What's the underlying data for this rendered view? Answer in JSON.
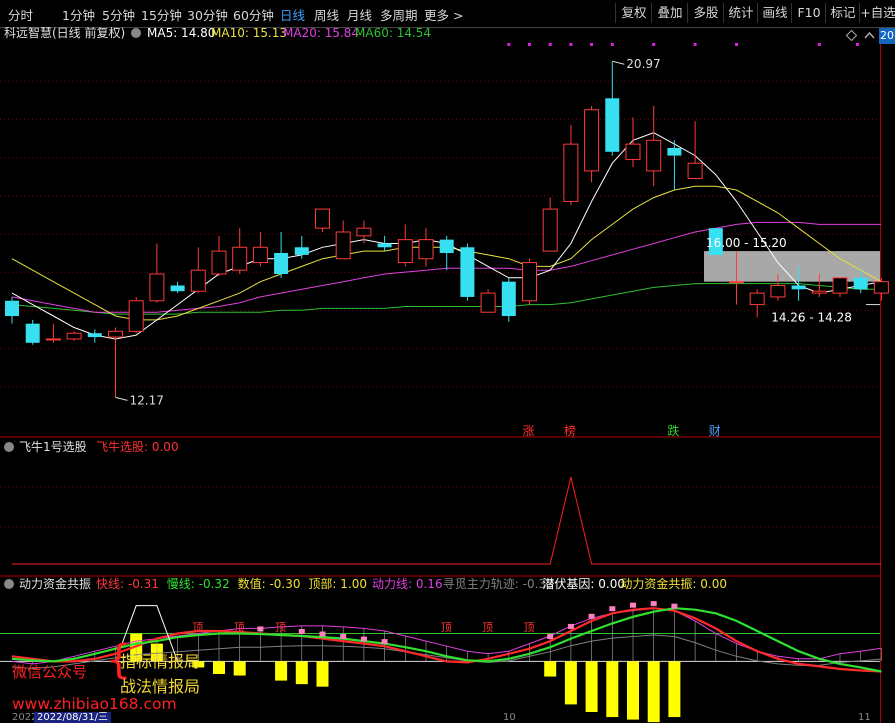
{
  "toolbar": {
    "periods": [
      {
        "label": "分时",
        "active": false
      },
      {
        "label": "1分钟",
        "active": false
      },
      {
        "label": "5分钟",
        "active": false
      },
      {
        "label": "15分钟",
        "active": false
      },
      {
        "label": "30分钟",
        "active": false
      },
      {
        "label": "60分钟",
        "active": false
      },
      {
        "label": "日线",
        "active": true
      },
      {
        "label": "周线",
        "active": false
      },
      {
        "label": "月线",
        "active": false
      },
      {
        "label": "多周期",
        "active": false
      },
      {
        "label": "更多 >",
        "active": false
      }
    ],
    "buttons": [
      "复权",
      "叠加",
      "多股",
      "统计",
      "画线",
      "F10",
      "标记",
      "+自选"
    ]
  },
  "main_info": {
    "title": "科远智慧(日线 前复权)",
    "ma5": "MA5: 14.80",
    "ma10": "MA10: 15.13",
    "ma20": "MA20: 15.84",
    "ma60": "MA60: 14.54",
    "right_tag": "20"
  },
  "colors": {
    "up": "#ff3a3a",
    "down": "#36e0f0",
    "ma5": "#ffffff",
    "ma10": "#e8e040",
    "ma20": "#e040e0",
    "ma60": "#30c030",
    "grid": "#7a0000",
    "signal": "#ff2020"
  },
  "chart_data": [
    {
      "type": "candlestick",
      "name": "main",
      "ylim": [
        11.5,
        21.5
      ],
      "candles": [
        {
          "o": 14.7,
          "c": 14.3,
          "h": 14.8,
          "l": 14.1
        },
        {
          "o": 14.1,
          "c": 13.6,
          "h": 14.2,
          "l": 13.55
        },
        {
          "o": 13.7,
          "c": 13.7,
          "h": 14.1,
          "l": 13.6
        },
        {
          "o": 13.7,
          "c": 13.85,
          "h": 13.9,
          "l": 13.65
        },
        {
          "o": 13.85,
          "c": 13.75,
          "h": 13.95,
          "l": 13.6
        },
        {
          "o": 13.75,
          "c": 13.9,
          "h": 14.0,
          "l": 12.17
        },
        {
          "o": 13.9,
          "c": 14.7,
          "h": 14.8,
          "l": 13.85
        },
        {
          "o": 14.7,
          "c": 15.4,
          "h": 16.2,
          "l": 14.65
        },
        {
          "o": 15.1,
          "c": 14.95,
          "h": 15.2,
          "l": 14.9
        },
        {
          "o": 14.95,
          "c": 15.5,
          "h": 16.1,
          "l": 14.9
        },
        {
          "o": 15.4,
          "c": 16.0,
          "h": 16.4,
          "l": 15.35
        },
        {
          "o": 15.5,
          "c": 16.1,
          "h": 16.6,
          "l": 15.4
        },
        {
          "o": 15.7,
          "c": 16.1,
          "h": 16.5,
          "l": 15.6
        },
        {
          "o": 15.95,
          "c": 15.4,
          "h": 16.5,
          "l": 15.3
        },
        {
          "o": 16.1,
          "c": 15.9,
          "h": 16.4,
          "l": 15.8
        },
        {
          "o": 16.6,
          "c": 17.1,
          "h": 17.1,
          "l": 16.5
        },
        {
          "o": 15.8,
          "c": 16.5,
          "h": 16.8,
          "l": 15.8
        },
        {
          "o": 16.4,
          "c": 16.6,
          "h": 16.8,
          "l": 16.2
        },
        {
          "o": 16.2,
          "c": 16.1,
          "h": 16.4,
          "l": 16.0
        },
        {
          "o": 15.7,
          "c": 16.3,
          "h": 16.7,
          "l": 15.6
        },
        {
          "o": 15.8,
          "c": 16.3,
          "h": 16.6,
          "l": 15.6
        },
        {
          "o": 16.3,
          "c": 15.95,
          "h": 16.4,
          "l": 15.5
        },
        {
          "o": 16.1,
          "c": 14.8,
          "h": 16.2,
          "l": 14.7
        },
        {
          "o": 14.4,
          "c": 14.9,
          "h": 15.0,
          "l": 14.4
        },
        {
          "o": 15.2,
          "c": 14.3,
          "h": 15.3,
          "l": 14.15
        },
        {
          "o": 14.7,
          "c": 15.7,
          "h": 15.8,
          "l": 14.6
        },
        {
          "o": 16.0,
          "c": 17.1,
          "h": 17.4,
          "l": 16.0
        },
        {
          "o": 17.3,
          "c": 18.8,
          "h": 19.3,
          "l": 17.2
        },
        {
          "o": 18.1,
          "c": 19.7,
          "h": 19.8,
          "l": 17.8
        },
        {
          "o": 20.0,
          "c": 18.6,
          "h": 20.97,
          "l": 18.5
        },
        {
          "o": 18.4,
          "c": 18.8,
          "h": 19.5,
          "l": 18.2
        },
        {
          "o": 18.1,
          "c": 18.9,
          "h": 19.8,
          "l": 17.7
        },
        {
          "o": 18.7,
          "c": 18.5,
          "h": 18.9,
          "l": 17.6
        },
        {
          "o": 17.9,
          "c": 18.3,
          "h": 19.4,
          "l": 17.9
        },
        {
          "o": 16.6,
          "c": 15.9,
          "h": 16.6,
          "l": 15.9
        },
        {
          "o": 15.2,
          "c": 15.2,
          "h": 16.0,
          "l": 14.6
        },
        {
          "o": 14.6,
          "c": 14.9,
          "h": 15.0,
          "l": 14.26
        },
        {
          "o": 14.8,
          "c": 15.1,
          "h": 15.4,
          "l": 14.7
        },
        {
          "o": 15.1,
          "c": 15.0,
          "h": 15.6,
          "l": 14.7
        },
        {
          "o": 14.9,
          "c": 14.95,
          "h": 15.4,
          "l": 14.8
        },
        {
          "o": 14.9,
          "c": 15.3,
          "h": 15.3,
          "l": 14.8
        },
        {
          "o": 15.3,
          "c": 15.0,
          "h": 15.5,
          "l": 14.9
        },
        {
          "o": 14.9,
          "c": 15.2,
          "h": 15.3,
          "l": 14.7
        }
      ],
      "ma5": [
        14.9,
        14.6,
        14.3,
        14.0,
        13.8,
        13.7,
        13.8,
        14.2,
        14.6,
        15.0,
        15.4,
        15.6,
        15.8,
        15.8,
        15.9,
        16.1,
        16.2,
        16.3,
        16.2,
        16.2,
        16.3,
        16.2,
        15.9,
        15.6,
        15.3,
        15.3,
        15.5,
        16.2,
        17.3,
        18.3,
        18.9,
        19.1,
        18.8,
        18.5,
        18.0,
        17.3,
        16.5,
        15.7,
        15.1,
        14.9,
        15.0,
        15.1,
        15.2
      ],
      "ma10": [
        15.8,
        15.5,
        15.2,
        14.9,
        14.6,
        14.3,
        14.2,
        14.2,
        14.3,
        14.5,
        14.7,
        14.9,
        15.2,
        15.4,
        15.6,
        15.8,
        15.9,
        16.0,
        16.0,
        16.1,
        16.1,
        16.1,
        16.0,
        15.9,
        15.8,
        15.6,
        15.6,
        15.8,
        16.3,
        16.7,
        17.1,
        17.4,
        17.6,
        17.7,
        17.7,
        17.6,
        17.3,
        17.0,
        16.6,
        16.2,
        15.8,
        15.5,
        15.2
      ],
      "ma20": [
        14.8,
        14.7,
        14.6,
        14.5,
        14.4,
        14.4,
        14.4,
        14.4,
        14.45,
        14.5,
        14.55,
        14.65,
        14.8,
        14.9,
        15.0,
        15.1,
        15.2,
        15.3,
        15.4,
        15.45,
        15.5,
        15.55,
        15.55,
        15.55,
        15.55,
        15.5,
        15.5,
        15.6,
        15.75,
        15.9,
        16.05,
        16.2,
        16.35,
        16.5,
        16.6,
        16.7,
        16.75,
        16.75,
        16.75,
        16.7,
        16.7,
        16.7,
        16.7
      ],
      "ma60": [
        14.6,
        14.55,
        14.5,
        14.45,
        14.4,
        14.35,
        14.35,
        14.35,
        14.35,
        14.4,
        14.4,
        14.4,
        14.4,
        14.45,
        14.45,
        14.5,
        14.5,
        14.5,
        14.5,
        14.55,
        14.55,
        14.55,
        14.55,
        14.55,
        14.55,
        14.6,
        14.6,
        14.65,
        14.75,
        14.85,
        14.95,
        15.05,
        15.1,
        15.15,
        15.15,
        15.15,
        15.15,
        15.15,
        15.15,
        15.1,
        15.05,
        15.0,
        15.0
      ],
      "annotations": {
        "high_label": "20.97",
        "low_label": "12.17",
        "range_box_label": "16.00 - 15.20",
        "range_label": "14.26 - 14.28"
      },
      "range_box": [
        15.2,
        16.0
      ],
      "markers": [
        {
          "idx": 25,
          "text": "涨"
        },
        {
          "idx": 27,
          "text": "榜"
        },
        {
          "idx": 32,
          "text": "跌"
        },
        {
          "idx": 34,
          "text": "财"
        }
      ]
    },
    {
      "type": "line",
      "name": "飞牛选股",
      "title": "飞牛1号选股",
      "series_label": "飞牛选股: 0.00",
      "signal": [
        0,
        0,
        0,
        0,
        0,
        0,
        0,
        0,
        0,
        0,
        0,
        0,
        0,
        0,
        0,
        0,
        0,
        0,
        0,
        0,
        0,
        0,
        0,
        0,
        0,
        0,
        0,
        1,
        0,
        0,
        0,
        0,
        0,
        0,
        0,
        0,
        0,
        0,
        0,
        0,
        0,
        0,
        0
      ],
      "ylim": [
        0,
        1
      ]
    },
    {
      "type": "line",
      "name": "动力资金共振",
      "title": "动力资金共振",
      "legend": [
        {
          "text": "快线: -0.31",
          "color": "#ff3a3a"
        },
        {
          "text": "慢线: -0.32",
          "color": "#30e030"
        },
        {
          "text": "数值: -0.30",
          "color": "#f0e030"
        },
        {
          "text": "顶部: 1.00",
          "color": "#f0e030"
        },
        {
          "text": "动力线: 0.16",
          "color": "#e040e0"
        },
        {
          "text": "寻觅主力轨迹: -0.33",
          "color": "#808080"
        },
        {
          "text": "潜伏基因: 0.00",
          "color": "#ffffff"
        },
        {
          "text": "动力资金共振: 0.00",
          "color": "#f0e030"
        }
      ],
      "ylim": [
        -1.1,
        1.25
      ],
      "fast": [
        0.0,
        -0.05,
        -0.1,
        -0.1,
        -0.05,
        0.05,
        0.2,
        0.35,
        0.45,
        0.5,
        0.5,
        0.48,
        0.45,
        0.42,
        0.4,
        0.35,
        0.3,
        0.25,
        0.2,
        0.1,
        0.0,
        -0.1,
        -0.12,
        -0.05,
        0.05,
        0.15,
        0.3,
        0.5,
        0.7,
        0.85,
        0.92,
        0.95,
        0.9,
        0.75,
        0.55,
        0.3,
        0.1,
        -0.05,
        -0.15,
        -0.2,
        -0.25,
        -0.28,
        -0.3
      ],
      "slow": [
        -0.05,
        -0.08,
        -0.1,
        -0.05,
        0.05,
        0.15,
        0.25,
        0.3,
        0.38,
        0.42,
        0.45,
        0.45,
        0.44,
        0.42,
        0.4,
        0.38,
        0.35,
        0.3,
        0.25,
        0.18,
        0.1,
        0.0,
        -0.08,
        -0.1,
        -0.05,
        0.05,
        0.18,
        0.35,
        0.5,
        0.65,
        0.78,
        0.88,
        0.95,
        0.92,
        0.85,
        0.7,
        0.5,
        0.3,
        0.1,
        -0.05,
        -0.15,
        -0.22,
        -0.3
      ],
      "power": [
        -0.1,
        -0.15,
        -0.1,
        0.0,
        0.1,
        0.2,
        0.3,
        0.35,
        0.4,
        0.45,
        0.5,
        0.55,
        0.55,
        0.58,
        0.6,
        0.6,
        0.58,
        0.55,
        0.5,
        0.4,
        0.3,
        0.2,
        0.1,
        0.05,
        0.1,
        0.25,
        0.4,
        0.6,
        0.75,
        0.85,
        0.9,
        0.95,
        0.9,
        0.7,
        0.45,
        0.25,
        0.1,
        0.0,
        -0.05,
        -0.05,
        0.05,
        0.1,
        0.16
      ],
      "bars": [
        0,
        0,
        0,
        0,
        0,
        0,
        0.55,
        0.35,
        0,
        -0.12,
        -0.25,
        -0.28,
        0,
        -0.38,
        -0.45,
        -0.5,
        0,
        0,
        0,
        0,
        0,
        0,
        0,
        0,
        0,
        0,
        -0.3,
        -0.85,
        -1.0,
        -1.1,
        -1.15,
        -1.2,
        -1.1,
        0,
        0,
        0,
        0,
        0,
        0,
        0,
        0,
        0,
        0
      ],
      "tops": [
        12,
        14,
        15,
        16,
        17,
        18,
        26,
        27,
        28,
        29,
        30,
        31,
        32
      ],
      "labels": [
        {
          "idx": 9,
          "text": "顶"
        },
        {
          "idx": 11,
          "text": "顶"
        },
        {
          "idx": 13,
          "text": "顶"
        },
        {
          "idx": 21,
          "text": "顶"
        },
        {
          "idx": 23,
          "text": "顶"
        },
        {
          "idx": 25,
          "text": "顶"
        }
      ]
    }
  ],
  "sub1_info": {
    "title": "飞牛1号选股",
    "value": "飞牛选股: 0.00"
  },
  "sub2_info": {
    "title": "动力资金共振"
  },
  "watermark": {
    "line1": "微信公众号",
    "line2": "指标情报局",
    "line3": "战法情报局",
    "line4": "www.zhibiao168.com"
  },
  "date_bar": {
    "date": "2022/08/31/三",
    "year": "2022",
    "mid": "10",
    "end": "11"
  }
}
